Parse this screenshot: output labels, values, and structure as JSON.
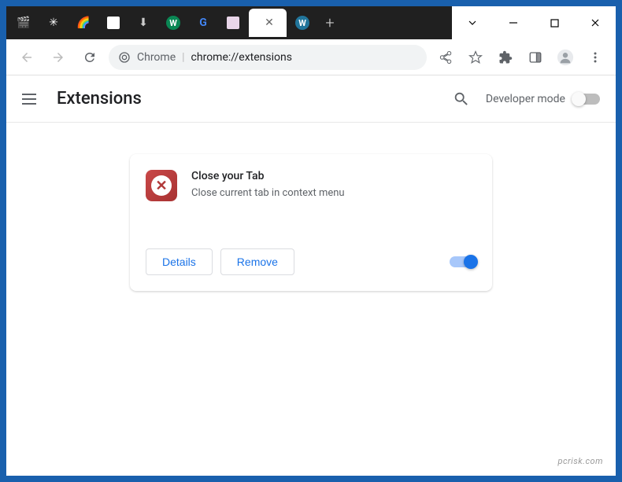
{
  "window": {
    "tabs": [
      {
        "icon": "film",
        "active": false
      },
      {
        "icon": "reel",
        "active": false
      },
      {
        "icon": "google",
        "active": false
      },
      {
        "icon": "doc",
        "active": false
      },
      {
        "icon": "download",
        "active": false
      },
      {
        "icon": "w-green",
        "active": false
      },
      {
        "icon": "g-color",
        "active": false
      },
      {
        "icon": "robot",
        "active": false
      },
      {
        "icon": "none",
        "active": true
      },
      {
        "icon": "wp",
        "active": false
      }
    ],
    "controls": {
      "minimize": "–",
      "maximize": "☐",
      "close": "✕"
    }
  },
  "toolbar": {
    "chrome_label": "Chrome",
    "url": "chrome://extensions"
  },
  "header": {
    "title": "Extensions",
    "dev_mode_label": "Developer mode"
  },
  "extension": {
    "name": "Close your Tab",
    "description": "Close current tab in context menu",
    "details_label": "Details",
    "remove_label": "Remove",
    "enabled": true
  },
  "watermark": "pcrisk.com"
}
